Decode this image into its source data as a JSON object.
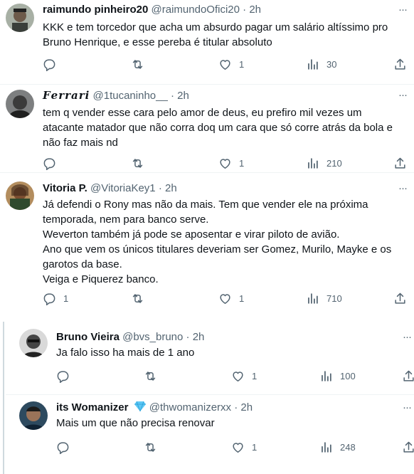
{
  "tweets": [
    {
      "name": "raimundo pinheiro20",
      "handle": "@raimundoOfici20",
      "time": "2h",
      "text": "KKK e tem torcedor que acha um absurdo pagar um salário altíssimo pro\nBruno Henrique, e esse pereba é titular absoluto",
      "replies": "",
      "retweets": "",
      "likes": "1",
      "views": "30"
    },
    {
      "name": "𝑭𝒆𝒓𝒓𝒂𝒓𝒊",
      "handle": "@1tucaninho__",
      "time": "2h",
      "text": "tem q vender esse cara pelo amor de deus, eu prefiro mil vezes um\natacante matador que não corra doq um cara que só corre atrás da bola e\nnão faz mais nd",
      "replies": "",
      "retweets": "",
      "likes": "1",
      "views": "210"
    },
    {
      "name": "Vitoria P.",
      "handle": "@VitoriaKey1",
      "time": "2h",
      "text": "Já defendi o Rony mas não da mais. Tem que vender ele na próxima\ntemporada, nem para banco serve.\nWeverton também já pode se aposentar e virar piloto de avião.\nAno que vem os únicos titulares deveriam ser Gomez, Murilo, Mayke e os\ngarotos da base.\nVeiga e Piquerez banco.",
      "replies": "1",
      "retweets": "",
      "likes": "1",
      "views": "710"
    },
    {
      "name": "Bruno Vieira",
      "handle": "@bvs_bruno",
      "time": "2h",
      "text": "Ja falo isso ha mais de 1 ano",
      "replies": "",
      "retweets": "",
      "likes": "1",
      "views": "100"
    },
    {
      "name": "its Womanizer",
      "verified_icon": "blue-diamond-icon",
      "handle": "@thwomanizerxx",
      "time": "2h",
      "text": "Mais um que não precisa renovar",
      "replies": "",
      "retweets": "",
      "likes": "1",
      "views": "248"
    }
  ],
  "separator": "·",
  "colors": {
    "text": "#0f1419",
    "muted": "#536471",
    "border": "#eff3f4",
    "thread": "#cfd9de",
    "badge": "#1d9bf0"
  }
}
